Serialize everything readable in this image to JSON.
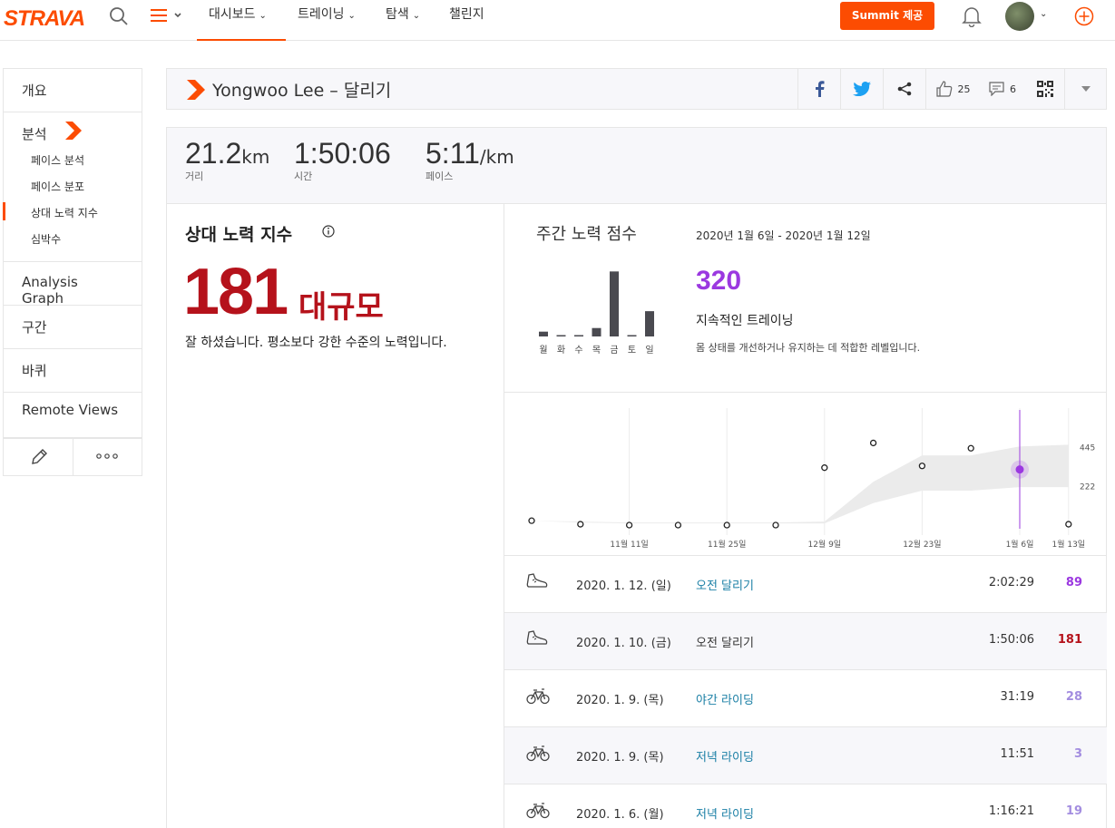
{
  "nav": {
    "logo": "STRAVA",
    "items": [
      {
        "label": "대시보드",
        "has_chevron": true
      },
      {
        "label": "트레이닝",
        "has_chevron": true
      },
      {
        "label": "탐색",
        "has_chevron": true
      },
      {
        "label": "챌린지",
        "has_chevron": false
      }
    ],
    "summit_label": "Summit 제공",
    "accent": "#fc4c02"
  },
  "sidebar": {
    "overview": "개요",
    "analysis": "분석",
    "subitems": [
      "페이스 분석",
      "페이스 분포",
      "상대 노력 지수",
      "심박수"
    ],
    "active_subitem": 2,
    "items": [
      "Analysis Graph",
      "구간",
      "바퀴",
      "Remote Views"
    ]
  },
  "header": {
    "title": "Yongwoo Lee – 달리기",
    "kudos_count": "25",
    "comment_count": "6"
  },
  "stats": [
    {
      "value": "21.2",
      "unit": "km",
      "label": "거리"
    },
    {
      "value": "1:50:06",
      "unit": "",
      "label": "시간"
    },
    {
      "value": "5:11",
      "unit": "/km",
      "label": "페이스"
    }
  ],
  "relative_effort": {
    "title": "상대 노력 지수",
    "score": "181",
    "level": "대규모",
    "message": "잘 하셨습니다. 평소보다 강한 수준의 노력입니다."
  },
  "weekly": {
    "title": "주간 노력 점수",
    "range": "2020년 1월 6일 - 2020년 1월 12일",
    "score": "320",
    "status": "지속적인 트레이닝",
    "description": "몸 상태를 개선하거나 유지하는 데 적합한 레벨입니다.",
    "score_color": "#9b38e0"
  },
  "chart_data": [
    {
      "type": "bar",
      "categories": [
        "월",
        "화",
        "수",
        "목",
        "금",
        "토",
        "일"
      ],
      "values": [
        8,
        1,
        1,
        14,
        108,
        1,
        42
      ],
      "ylim": [
        0,
        110
      ]
    },
    {
      "type": "scatter",
      "x": [
        "10월 28일",
        "11월 4일",
        "11월 11일",
        "11월 18일",
        "11월 25일",
        "12월 2일",
        "12월 9일",
        "12월 16일",
        "12월 23일",
        "12월 30일",
        "1월 6일",
        "1월 13일"
      ],
      "values": [
        30,
        10,
        5,
        5,
        5,
        5,
        330,
        470,
        340,
        440,
        320,
        10
      ],
      "xtick_labels": [
        "11월 11일",
        "11월 25일",
        "12월 9일",
        "12월 23일",
        "1월 6일",
        "1월 13일"
      ],
      "ytick_labels": [
        "445",
        "222"
      ],
      "yticks": [
        445,
        222
      ],
      "band_low": [
        30,
        20,
        15,
        15,
        15,
        15,
        15,
        130,
        200,
        200,
        220,
        220
      ],
      "band_high": [
        30,
        25,
        20,
        20,
        20,
        20,
        25,
        250,
        400,
        400,
        450,
        460
      ],
      "highlight_index": 10,
      "ylim": [
        0,
        580
      ],
      "accent": "#9b38e0"
    }
  ],
  "activities": [
    {
      "type": "run",
      "date": "2020. 1. 12. (일)",
      "name": "오전 달리기",
      "name_link": true,
      "time": "2:02:29",
      "score": "89",
      "score_color": "#9b38e0"
    },
    {
      "type": "run",
      "date": "2020. 1. 10. (금)",
      "name": "오전 달리기",
      "name_link": false,
      "time": "1:50:06",
      "score": "181",
      "score_color": "#b5121b"
    },
    {
      "type": "ride",
      "date": "2020. 1. 9. (목)",
      "name": "야간 라이딩",
      "name_link": true,
      "time": "31:19",
      "score": "28",
      "score_color": "#a38de0"
    },
    {
      "type": "ride",
      "date": "2020. 1. 9. (목)",
      "name": "저녁 라이딩",
      "name_link": true,
      "time": "11:51",
      "score": "3",
      "score_color": "#a38de0"
    },
    {
      "type": "ride",
      "date": "2020. 1. 6. (월)",
      "name": "저녁 라이딩",
      "name_link": true,
      "time": "1:16:21",
      "score": "19",
      "score_color": "#a38de0"
    }
  ]
}
